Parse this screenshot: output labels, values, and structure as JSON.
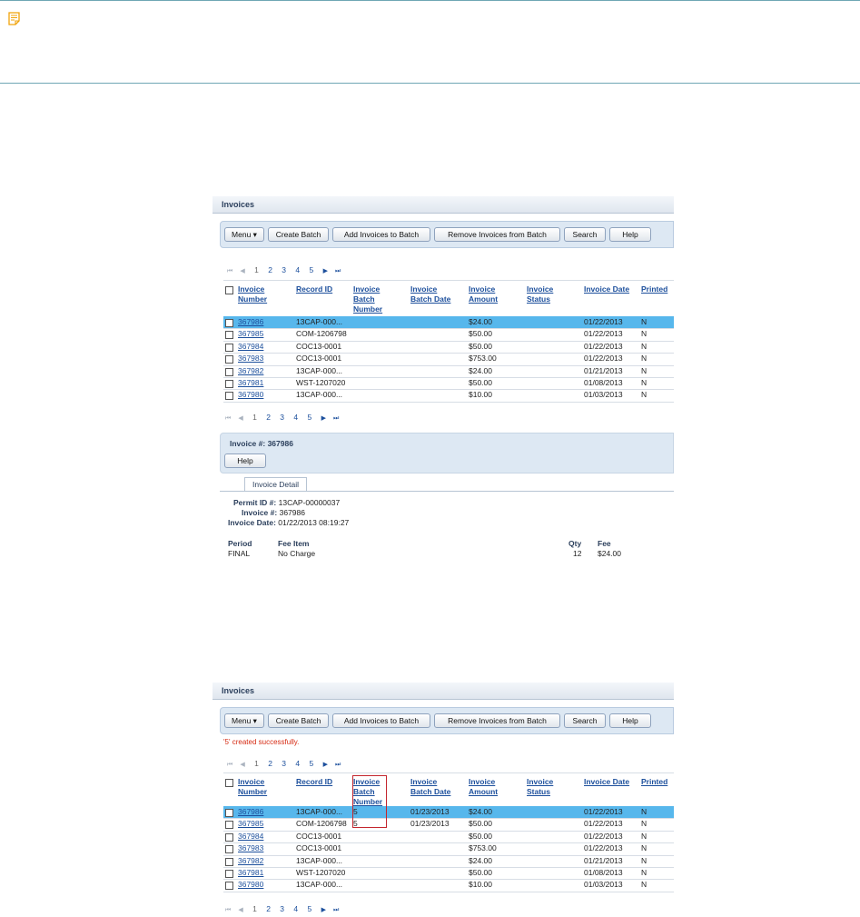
{
  "note": {
    "icon": "note-icon"
  },
  "shot1": {
    "panel_title": "Invoices",
    "toolbar": {
      "menu": "Menu ▾",
      "create_batch": "Create Batch",
      "add_invoices": "Add Invoices to Batch",
      "remove_invoices": "Remove Invoices from Batch",
      "search": "Search",
      "help": "Help"
    },
    "pager": {
      "pages": [
        "1",
        "2",
        "3",
        "4",
        "5"
      ]
    },
    "columns": [
      "Invoice\nNumber",
      "Record ID",
      "Invoice\nBatch\nNumber",
      "Invoice\nBatch Date",
      "Invoice\nAmount",
      "Invoice\nStatus",
      "Invoice Date",
      "Printed"
    ],
    "rows": [
      {
        "number": "367986",
        "record": "13CAP-000...",
        "batch": "",
        "batch_date": "",
        "amount": "$24.00",
        "status": "",
        "date": "01/22/2013",
        "printed": "N",
        "selected": true
      },
      {
        "number": "367985",
        "record": "COM-1206798",
        "batch": "",
        "batch_date": "",
        "amount": "$50.00",
        "status": "",
        "date": "01/22/2013",
        "printed": "N"
      },
      {
        "number": "367984",
        "record": "COC13-0001",
        "batch": "",
        "batch_date": "",
        "amount": "$50.00",
        "status": "",
        "date": "01/22/2013",
        "printed": "N"
      },
      {
        "number": "367983",
        "record": "COC13-0001",
        "batch": "",
        "batch_date": "",
        "amount": "$753.00",
        "status": "",
        "date": "01/22/2013",
        "printed": "N"
      },
      {
        "number": "367982",
        "record": "13CAP-000...",
        "batch": "",
        "batch_date": "",
        "amount": "$24.00",
        "status": "",
        "date": "01/21/2013",
        "printed": "N"
      },
      {
        "number": "367981",
        "record": "WST-1207020",
        "batch": "",
        "batch_date": "",
        "amount": "$50.00",
        "status": "",
        "date": "01/08/2013",
        "printed": "N"
      },
      {
        "number": "367980",
        "record": "13CAP-000...",
        "batch": "",
        "batch_date": "",
        "amount": "$10.00",
        "status": "",
        "date": "01/03/2013",
        "printed": "N"
      }
    ],
    "detail": {
      "invoice_label": "Invoice #: 367986",
      "help": "Help",
      "tab": "Invoice Detail",
      "permit_label": "Permit ID #:",
      "permit_value": "13CAP-00000037",
      "invoice_num_label": "Invoice #:",
      "invoice_num_value": "367986",
      "invoice_date_label": "Invoice Date:",
      "invoice_date_value": "01/22/2013 08:19:27",
      "fee_headers": {
        "period": "Period",
        "fee_item": "Fee Item",
        "qty": "Qty",
        "fee": "Fee"
      },
      "fee_row": {
        "period": "FINAL",
        "fee_item": "No Charge",
        "qty": "12",
        "fee": "$24.00"
      }
    }
  },
  "shot2": {
    "panel_title": "Invoices",
    "toolbar": {
      "menu": "Menu ▾",
      "create_batch": "Create Batch",
      "add_invoices": "Add Invoices to Batch",
      "remove_invoices": "Remove Invoices from Batch",
      "search": "Search",
      "help": "Help"
    },
    "message": "'5' created successfully.",
    "pager": {
      "pages": [
        "1",
        "2",
        "3",
        "4",
        "5"
      ]
    },
    "columns": [
      "Invoice\nNumber",
      "Record ID",
      "Invoice\nBatch\nNumber",
      "Invoice\nBatch Date",
      "Invoice\nAmount",
      "Invoice\nStatus",
      "Invoice Date",
      "Printed"
    ],
    "rows": [
      {
        "number": "367986",
        "record": "13CAP-000...",
        "batch": "5",
        "batch_date": "01/23/2013",
        "amount": "$24.00",
        "status": "",
        "date": "01/22/2013",
        "printed": "N",
        "selected": true
      },
      {
        "number": "367985",
        "record": "COM-1206798",
        "batch": "5",
        "batch_date": "01/23/2013",
        "amount": "$50.00",
        "status": "",
        "date": "01/22/2013",
        "printed": "N"
      },
      {
        "number": "367984",
        "record": "COC13-0001",
        "batch": "",
        "batch_date": "",
        "amount": "$50.00",
        "status": "",
        "date": "01/22/2013",
        "printed": "N"
      },
      {
        "number": "367983",
        "record": "COC13-0001",
        "batch": "",
        "batch_date": "",
        "amount": "$753.00",
        "status": "",
        "date": "01/22/2013",
        "printed": "N"
      },
      {
        "number": "367982",
        "record": "13CAP-000...",
        "batch": "",
        "batch_date": "",
        "amount": "$24.00",
        "status": "",
        "date": "01/21/2013",
        "printed": "N"
      },
      {
        "number": "367981",
        "record": "WST-1207020",
        "batch": "",
        "batch_date": "",
        "amount": "$50.00",
        "status": "",
        "date": "01/08/2013",
        "printed": "N"
      },
      {
        "number": "367980",
        "record": "13CAP-000...",
        "batch": "",
        "batch_date": "",
        "amount": "$10.00",
        "status": "",
        "date": "01/03/2013",
        "printed": "N"
      }
    ]
  },
  "colors": {
    "accent": "#1c4f9c",
    "selected_row": "#57b7ec",
    "toolbar_bg": "#dde8f3",
    "success_text": "#d62b13",
    "highlight_box": "#c4262e",
    "note_border": "#6fa7b4"
  }
}
